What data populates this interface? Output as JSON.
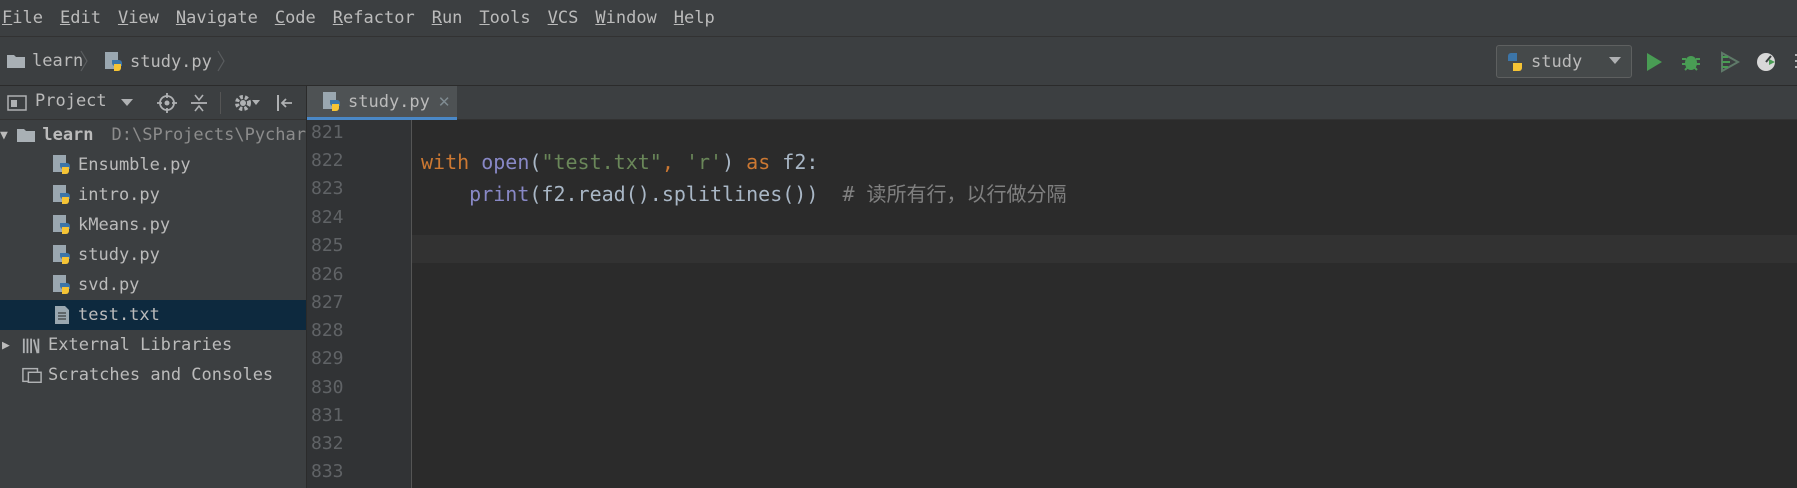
{
  "menu": [
    "File",
    "Edit",
    "View",
    "Navigate",
    "Code",
    "Refactor",
    "Run",
    "Tools",
    "VCS",
    "Window",
    "Help"
  ],
  "breadcrumb": {
    "project": "learn",
    "file": "study.py"
  },
  "run_config": {
    "name": "study"
  },
  "project_panel": {
    "title": "Project",
    "root": {
      "name": "learn",
      "path": "D:\\SProjects\\Pychar"
    },
    "files": [
      "Ensumble.py",
      "intro.py",
      "kMeans.py",
      "study.py",
      "svd.py",
      "test.txt"
    ],
    "selected": "test.txt",
    "external_libraries": "External Libraries",
    "scratches": "Scratches and Consoles"
  },
  "editor": {
    "tab": "study.py",
    "line_numbers": [
      "821",
      "822",
      "823",
      "824",
      "825",
      "826",
      "827",
      "828",
      "829",
      "830",
      "831",
      "832",
      "833"
    ],
    "code": {
      "l822": {
        "kw_with": "with",
        "fn_open": "open",
        "p1": "(",
        "s1": "\"test.txt\"",
        "comma": ", ",
        "s2": "'r'",
        "p2": ") ",
        "kw_as": "as",
        "rest": " f2:"
      },
      "l823": {
        "indent": "    ",
        "fn_print": "print",
        "mid": "(f2.read().splitlines())",
        "comment": "  # 读所有行，以行做分隔"
      }
    }
  },
  "colors": {
    "accent": "#4a88c7",
    "run_green": "#499c54",
    "python_blue": "#3c75a8",
    "python_yellow": "#f6c435"
  }
}
